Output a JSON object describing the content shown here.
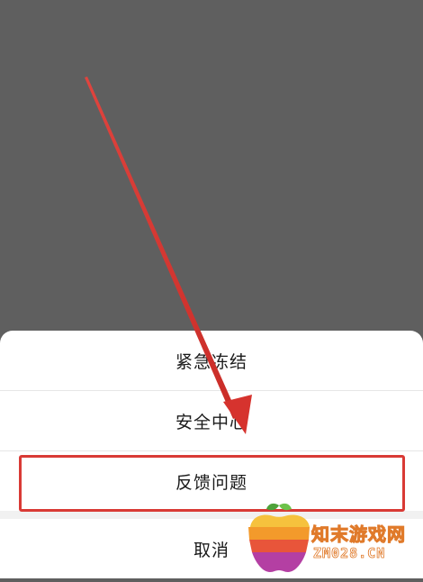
{
  "sheet": {
    "items": [
      {
        "label": "紧急冻结"
      },
      {
        "label": "安全中心"
      },
      {
        "label": "反馈问题"
      }
    ],
    "cancel_label": "取消"
  },
  "annotation": {
    "arrow_color": "#d93a35",
    "highlight_color": "#d93a35"
  },
  "watermark": {
    "name_cn": "知末游戏网",
    "name_en": "ZM028.CN"
  }
}
